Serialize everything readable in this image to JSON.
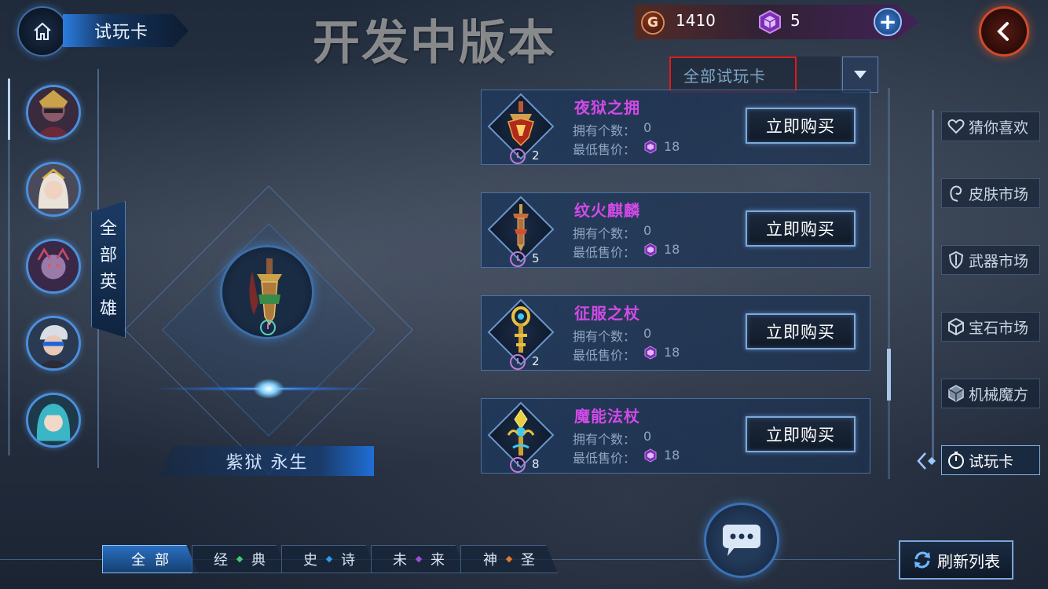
{
  "header": {
    "title": "试玩卡",
    "dev_watermark": "开发中版本",
    "gold_symbol": "G",
    "gold_amount": "1410",
    "gem_amount": "5",
    "plus_symbol": "+"
  },
  "hero_panel": {
    "all_heroes_chars": [
      "全",
      "部",
      "英",
      "雄"
    ],
    "avatars": [
      "hero-avatar-1",
      "hero-avatar-2",
      "hero-avatar-3",
      "hero-avatar-4",
      "hero-avatar-5"
    ]
  },
  "showcase": {
    "name": "紫狱 永生"
  },
  "filter": {
    "selected": "全部试玩卡"
  },
  "items": [
    {
      "name": "夜狱之拥",
      "count": "2",
      "owned_label": "拥有个数：",
      "owned": "0",
      "price_label": "最低售价：",
      "price": "18",
      "buy_label": "立即购买"
    },
    {
      "name": "纹火麒麟",
      "count": "5",
      "owned_label": "拥有个数：",
      "owned": "0",
      "price_label": "最低售价：",
      "price": "18",
      "buy_label": "立即购买"
    },
    {
      "name": "征服之杖",
      "count": "2",
      "owned_label": "拥有个数：",
      "owned": "0",
      "price_label": "最低售价：",
      "price": "18",
      "buy_label": "立即购买"
    },
    {
      "name": "魔能法杖",
      "count": "8",
      "owned_label": "拥有个数：",
      "owned": "0",
      "price_label": "最低售价：",
      "price": "18",
      "buy_label": "立即购买"
    }
  ],
  "side_nav": [
    {
      "label": "猜你喜欢",
      "icon": "heart-icon"
    },
    {
      "label": "皮肤市场",
      "icon": "skin-icon"
    },
    {
      "label": "武器市场",
      "icon": "shield-icon"
    },
    {
      "label": "宝石市场",
      "icon": "gem-cube-icon"
    },
    {
      "label": "机械魔方",
      "icon": "mech-cube-icon"
    },
    {
      "label": "试玩卡",
      "icon": "timer-icon",
      "active": true
    }
  ],
  "bottom_tabs": [
    {
      "left": "全",
      "right": "部",
      "dot_color": "",
      "active": true
    },
    {
      "left": "经",
      "right": "典",
      "dot_color": "#3ecf6a"
    },
    {
      "left": "史",
      "right": "诗",
      "dot_color": "#2e9be6"
    },
    {
      "left": "未",
      "right": "来",
      "dot_color": "#9b4fd6"
    },
    {
      "left": "神",
      "right": "圣",
      "dot_color": "#e07a2c"
    }
  ],
  "refresh_label": "刷新列表",
  "colors": {
    "accent_blue": "#4c8fdc",
    "item_name_purple": "#d24ae8",
    "highlight_red": "#e01a1a",
    "back_orange": "#d24a2a"
  }
}
